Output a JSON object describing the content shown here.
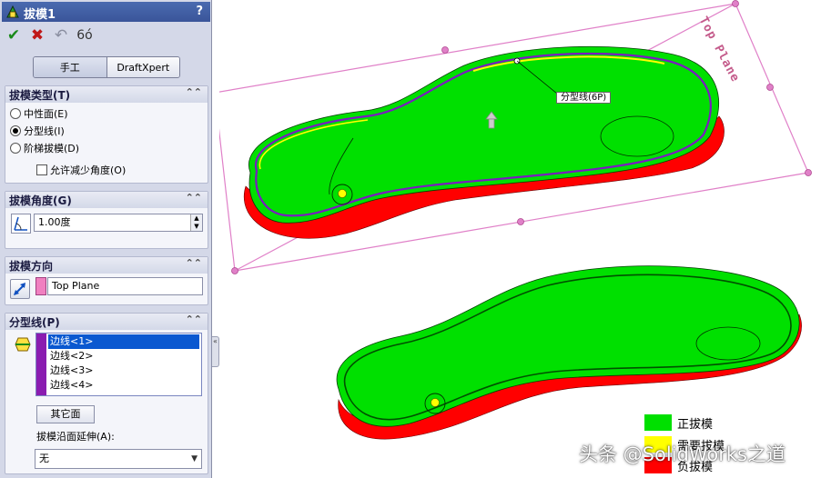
{
  "panel": {
    "title": "拔模1",
    "help": "?",
    "actions": {
      "ok": "✔",
      "cancel": "✖",
      "undo": "↶",
      "preview": "6ó"
    },
    "tabs": [
      "手工",
      "DraftXpert"
    ],
    "draft_type": {
      "header": "拔模类型(T)",
      "options": [
        "中性面(E)",
        "分型线(I)",
        "阶梯拔模(D)"
      ],
      "selected": "分型线(I)",
      "allow_reduce": "允许减少角度(O)"
    },
    "draft_angle": {
      "header": "拔模角度(G)",
      "value": "1.00度"
    },
    "direction": {
      "header": "拔模方向",
      "value": "Top Plane"
    },
    "parting": {
      "header": "分型线(P)",
      "edges": [
        "边线<1>",
        "边线<2>",
        "边线<3>",
        "边线<4>"
      ],
      "selected": "边线<1>",
      "other_face": "其它面",
      "extend_label": "拔模沿面延伸(A):",
      "extend_value": "无"
    },
    "collapse": "«"
  },
  "viewport": {
    "plane_label": "Top Plane",
    "parting_tag": "分型线(6P)",
    "legend": [
      {
        "label": "正拔模",
        "color": "#00e000"
      },
      {
        "label": "需要拔模",
        "color": "#ffff00"
      },
      {
        "label": "负拔模",
        "color": "#ff0000"
      }
    ]
  },
  "watermark": "头条 @SolidWorks之道",
  "colors": {
    "positive": "#00e000",
    "needed": "#ffff00",
    "negative": "#ff0000",
    "plane": "#e080c8",
    "parting": "#7a1cc0"
  }
}
